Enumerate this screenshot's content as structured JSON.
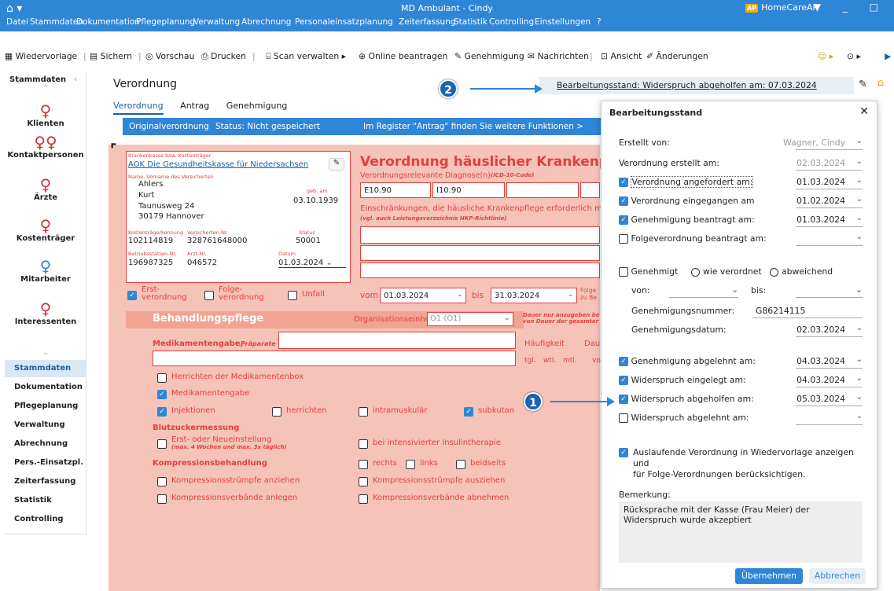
{
  "window": {
    "title": "MD Ambulant - Cindy",
    "brand_badge": "AP",
    "brand": "HomeCareAP",
    "home_glyph": "⌂ ▾"
  },
  "menu": [
    "Datei",
    "Stammdaten",
    "Dokumentation",
    "Pflegeplanung",
    "Verwaltung",
    "Abrechnung",
    "Personaleinsatzplanung",
    "Zeiterfassung",
    "Statistik",
    "Controlling",
    "Einstellungen",
    "?"
  ],
  "toolbar": {
    "wiedervorlage": "Wiedervorlage",
    "sichern": "Sichern",
    "vorschau": "Vorschau",
    "drucken": "Drucken",
    "scan": "Scan verwalten",
    "online": "Online beantragen",
    "genehmigung": "Genehmigung",
    "nachrichten": "Nachrichten",
    "ansicht": "Ansicht",
    "aenderungen": "Änderungen"
  },
  "sidebar": {
    "header": "Stammdaten",
    "icons": [
      {
        "label": "Klienten",
        "icon": "person-icon"
      },
      {
        "label": "Kontaktpersonen",
        "icon": "people-icon"
      },
      {
        "label": "Ärzte",
        "icon": "doctor-icon"
      },
      {
        "label": "Kostenträger",
        "icon": "payer-icon"
      },
      {
        "label": "Mitarbeiter",
        "icon": "employee-icon"
      },
      {
        "label": "Interessenten",
        "icon": "prospect-icon"
      }
    ],
    "sections": [
      "Stammdaten",
      "Dokumentation",
      "Pflegeplanung",
      "Verwaltung",
      "Abrechnung",
      "Pers.-Einsatzpl.",
      "Zeiterfassung",
      "Statistik",
      "Controlling"
    ]
  },
  "main": {
    "title": "Verordnung",
    "tabs": [
      "Verordnung",
      "Antrag",
      "Genehmigung"
    ],
    "bar_left": "Originalverordnung",
    "bar_status": "Status: Nicht gespeichert",
    "bar_right": "Im Register \"Antrag\" finden Sie weitere Funktionen >",
    "bearbeitungsstand": "Bearbeitungsstand: Widerspruch abgeholfen am: 07.03.2024"
  },
  "form": {
    "heading": "Verordnung häuslicher Krankenpflege",
    "kasse_label": "Krankenkasse bzw. Kostenträger",
    "kasse": "AOK Die Gesundheitskasse für Niedersachsen",
    "name_label": "Name, Vorname des Versicherten",
    "name1": "Ahlers",
    "name2": "Kurt",
    "street": "Taunusweg 24",
    "city": "30179 Hannover",
    "geb_label": "geb. am",
    "geb": "03.10.1939",
    "kt_label": "Kostenträgerkennung",
    "kt": "102114819",
    "vn_label": "Versicherten-Nr.",
    "vn": "328761648000",
    "status_label": "Status",
    "status": "50001",
    "bs_label": "Betriebsstätten-Nr.",
    "bs": "196987325",
    "arzt_label": "Arzt-Nr.",
    "arzt": "046572",
    "datum_label": "Datum",
    "datum": "01.03.2024",
    "diag_label": "Verordnungsrelevante Diagnose(n)",
    "diag_code": "(ICD-10-Code)",
    "diag1": "E10.90",
    "diag2": "I10.90",
    "einschr": "Einschränkungen, die häusliche Krankenpflege erforderlich ma",
    "einschr2": "(vgl. auch Leistungsverzeichnis HKP-Richtlinie)",
    "erst": "Erst-\nverordnung",
    "erst1": "Erst-",
    "erst2": "verordnung",
    "folge1": "Folge-",
    "folge2": "verordnung",
    "unfall": "Unfall",
    "vom_label": "vom",
    "vom": "01.03.2024",
    "bis_label": "bis",
    "bis": "31.03.2024",
    "folge_cut1": "Folge",
    "folge_cut2": "zu Be",
    "behandlung": "Behandlungspflege",
    "org_label": "Organisationseinheit:",
    "org": "O1 (O1)",
    "dauer1": "Dauer nur anzugeben be",
    "dauer2": "von Dauer der gesamter",
    "medi": "Medikamentengabe,",
    "medi_prep": "Präparate",
    "haeufig": "Häufigkeit",
    "dau": "Dau",
    "tgl": "tgl.",
    "wtl": "wtl.",
    "mtl": "mtl.",
    "vo": "vo",
    "items": {
      "box": "Herrichten der Medikamentenbox",
      "gabe": "Medikamentengabe",
      "inj": "Injektionen",
      "herrichten": "herrichten",
      "intram": "intramuskulär",
      "subkutan": "subkutan"
    },
    "blutzucker": "Blutzuckermessung",
    "erst_neu": "Erst- oder Neueinstellung",
    "erst_neu_sub": "(max. 4 Wochen und max. 3x täglich)",
    "intensiv": "bei intensivierter Insulintherapie",
    "kompression": "Kompressionsbehandlung",
    "rechts": "rechts",
    "links": "links",
    "beidseits": "beidseits",
    "k1": "Kompressionsstrümpfe anziehen",
    "k2": "Kompressionsstrümpfe ausziehen",
    "k3": "Kompressionsverbände anlegen",
    "k4": "Kompressionsverbände abnehmen"
  },
  "dialog": {
    "title": "Bearbeitungsstand",
    "erstellt_von_label": "Erstellt von:",
    "erstellt_von": "Wagner, Cindy",
    "erstellt_am_label": "Verordnung erstellt am:",
    "erstellt_am": "02.03.2024",
    "angefordert_label": "Verordnung angefordert am:",
    "angefordert": "01.03.2024",
    "eingegangen_label": "Verordnung eingegangen am",
    "eingegangen": "01.02.2024",
    "beantragt_label": "Genehmigung beantragt am:",
    "beantragt": "01.03.2024",
    "folge_label": "Folgeverordnung beantragt am:",
    "genehmigt": "Genehmigt",
    "wie_verordnet": "wie verordnet",
    "abweichend": "abweichend",
    "von_label": "von:",
    "bis_label": "bis:",
    "gnr_label": "Genehmigungsnummer:",
    "gnr": "G86214115",
    "gdatum_label": "Genehmigungsdatum:",
    "gdatum": "02.03.2024",
    "abgelehnt_label": "Genehmigung abgelehnt am:",
    "abgelehnt": "04.03.2024",
    "wein_label": "Widerspruch eingelegt am:",
    "wein": "04.03.2024",
    "wabg_label": "Widerspruch abgeholfen am:",
    "wabg": "05.03.2024",
    "wabl_label": "Widerspruch abgelehnt am:",
    "auslaufend1": "Auslaufende Verordnung in Wiedervorlage anzeigen und",
    "auslaufend2": "für Folge-Verordnungen berücksichtigen.",
    "bemerkung_label": "Bemerkung:",
    "bemerkung": "Rücksprache mit der Kasse (Frau Meier) der Widerspruch wurde akzeptiert",
    "ok": "Übernehmen",
    "cancel": "Abbrechen"
  },
  "markers": {
    "one": "1",
    "two": "2"
  },
  "colors": {
    "accent": "#2f86d6",
    "form_bg": "#f6c3b8",
    "form_red": "#e04040"
  }
}
